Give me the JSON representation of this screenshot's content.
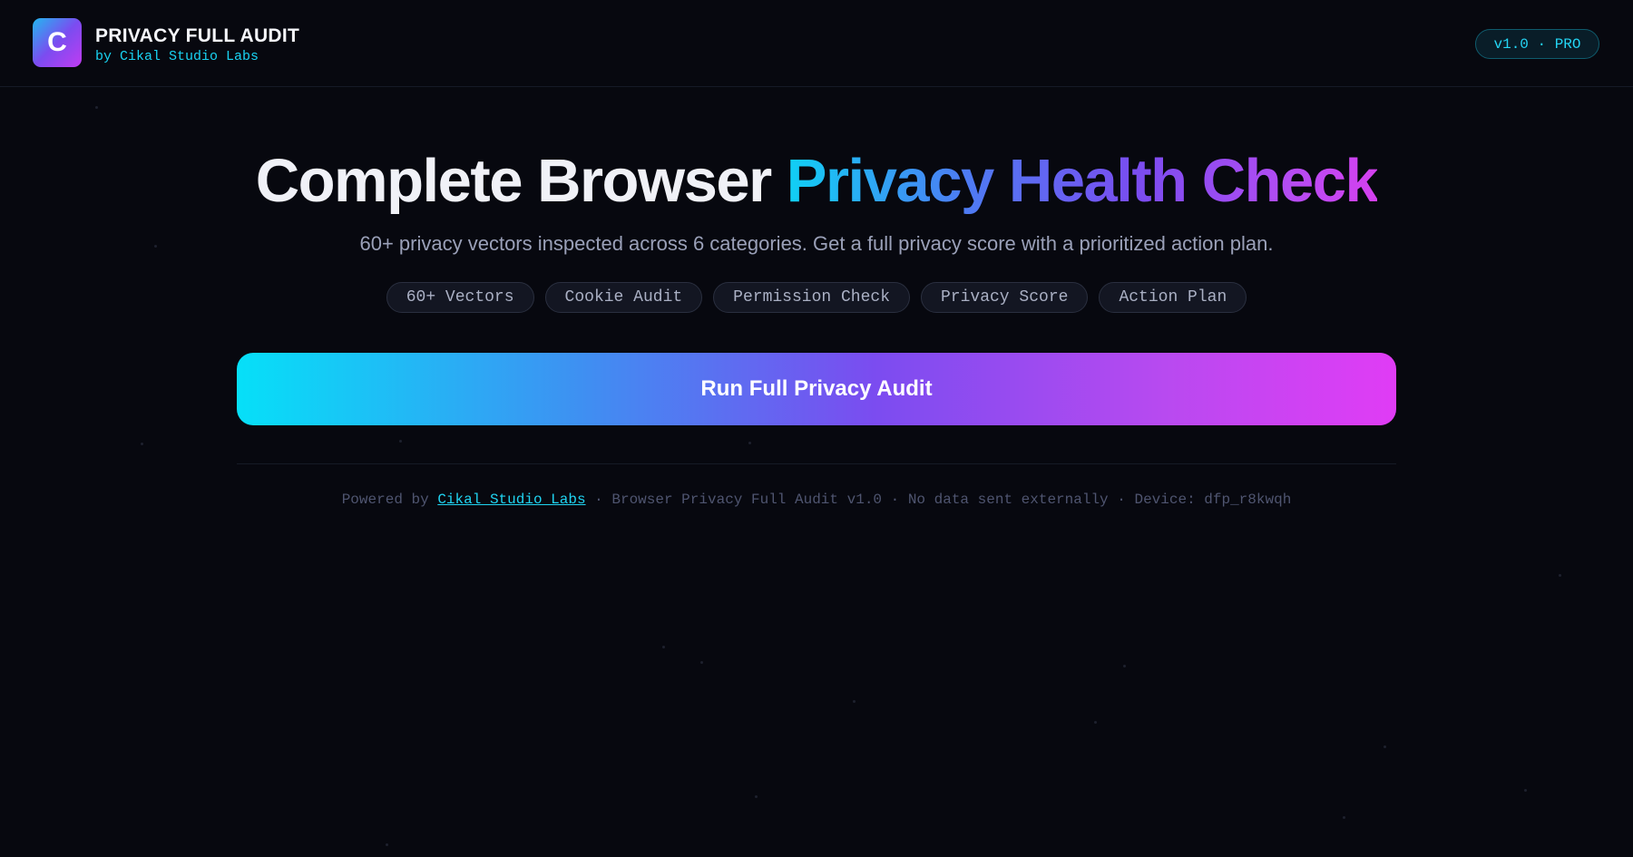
{
  "header": {
    "logo_letter": "C",
    "title": "PRIVACY FULL AUDIT",
    "subtitle": "by Cikal Studio Labs",
    "version_badge": "v1.0 · PRO"
  },
  "hero": {
    "title_plain": "Complete Browser",
    "title_gradient": "Privacy Health Check",
    "subtitle": "60+ privacy vectors inspected across 6 categories. Get a full privacy score with a prioritized action plan.",
    "chips": [
      "60+ Vectors",
      "Cookie Audit",
      "Permission Check",
      "Privacy Score",
      "Action Plan"
    ]
  },
  "actions": {
    "run_label": "Run Full Privacy Audit"
  },
  "footer": {
    "powered_prefix": "Powered by ",
    "link_text": "Cikal Studio Labs",
    "suffix": " · Browser Privacy Full Audit v1.0 · No data sent externally · Device: dfp_r8kwqh"
  },
  "colors": {
    "background": "#07080f",
    "accent_cyan": "#19d3f2",
    "accent_purple": "#7b4cf0",
    "accent_magenta": "#e03cf5"
  }
}
